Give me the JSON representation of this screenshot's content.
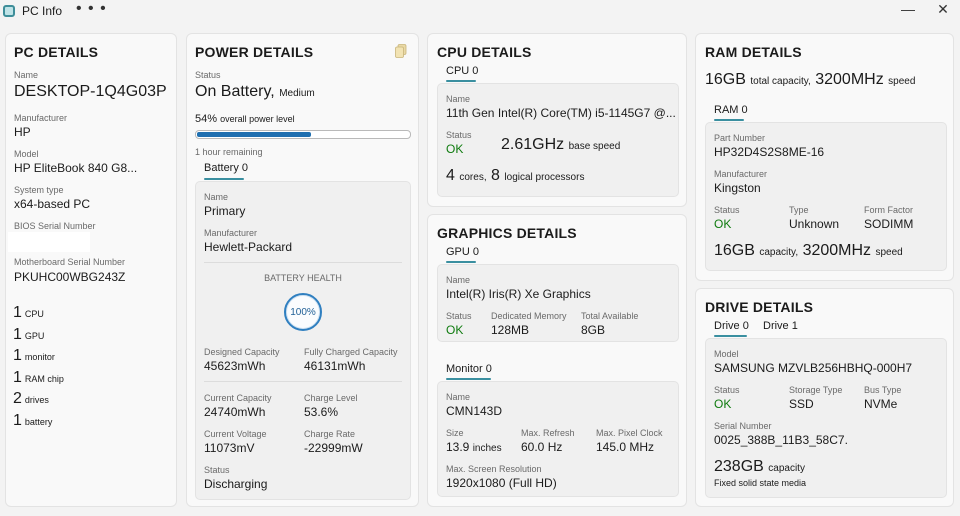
{
  "window": {
    "title": "PC Info",
    "more": "• • •",
    "minimize": "—",
    "close": "✕"
  },
  "pc": {
    "title": "PC DETAILS",
    "fields": [
      {
        "label": "Name",
        "value": "DESKTOP-1Q4G03P"
      },
      {
        "label": "Manufacturer",
        "value": "HP"
      },
      {
        "label": "Model",
        "value": "HP EliteBook 840 G8..."
      },
      {
        "label": "System type",
        "value": "x64-based PC"
      },
      {
        "label": "BIOS Serial Number",
        "value": ""
      },
      {
        "label": "Motherboard Serial Number",
        "value": "PKUHC00WBG243Z"
      }
    ],
    "counts": [
      {
        "n": "1",
        "unit": "CPU"
      },
      {
        "n": "1",
        "unit": "GPU"
      },
      {
        "n": "1",
        "unit": "monitor"
      },
      {
        "n": "1",
        "unit": "RAM chip"
      },
      {
        "n": "2",
        "unit": "drives"
      },
      {
        "n": "1",
        "unit": "battery"
      }
    ]
  },
  "power": {
    "title": "POWER DETAILS",
    "status_label": "Status",
    "status_value": "On Battery,",
    "status_level": "Medium",
    "percent": "54%",
    "percent_text": "overall power level",
    "level_fraction": 0.54,
    "time_left": "1 hour remaining",
    "tab": "Battery 0",
    "battery": {
      "name_label": "Name",
      "name": "Primary",
      "manufacturer_label": "Manufacturer",
      "manufacturer": "Hewlett-Packard",
      "health_label": "BATTERY HEALTH",
      "health": "100%",
      "designed_label": "Designed Capacity",
      "designed": "45623mWh",
      "full_label": "Fully Charged Capacity",
      "full": "46131mWh",
      "current_label": "Current Capacity",
      "current": "24740mWh",
      "charge_level_label": "Charge Level",
      "charge_level": "53.6%",
      "voltage_label": "Current Voltage",
      "voltage": "11073mV",
      "rate_label": "Charge Rate",
      "rate": "-22999mW",
      "status_label": "Status",
      "status": "Discharging"
    }
  },
  "cpu": {
    "title": "CPU DETAILS",
    "tab": "CPU 0",
    "name_label": "Name",
    "name": "11th Gen Intel(R) Core(TM) i5-1145G7 @...",
    "status_label": "Status",
    "status": "OK",
    "speed": "2.61GHz",
    "speed_text": "base speed",
    "cores": "4",
    "cores_text": "cores,",
    "logical": "8",
    "logical_text": "logical processors"
  },
  "graphics": {
    "title": "GRAPHICS DETAILS",
    "tab": "GPU 0",
    "name_label": "Name",
    "name": "Intel(R) Iris(R) Xe Graphics",
    "status_label": "Status",
    "status": "OK",
    "mem_label": "Dedicated Memory",
    "mem": "128MB",
    "total_label": "Total Available",
    "total": "8GB",
    "monitor_tab": "Monitor 0",
    "monitor": {
      "name_label": "Name",
      "name": "CMN143D",
      "size_label": "Size",
      "size": "13.9",
      "size_unit": "inches",
      "refresh_label": "Max. Refresh",
      "refresh": "60.0 Hz",
      "clock_label": "Max. Pixel Clock",
      "clock": "145.0 MHz",
      "res_label": "Max. Screen Resolution",
      "res": "1920x1080 (Full HD)"
    }
  },
  "ram": {
    "title": "RAM DETAILS",
    "capacity": "16GB",
    "capacity_text": "total capacity,",
    "speed": "3200MHz",
    "speed_text": "speed",
    "tab": "RAM 0",
    "part_label": "Part Number",
    "part": "HP32D4S2S8ME-16",
    "manufacturer_label": "Manufacturer",
    "manufacturer": "Kingston",
    "status_label": "Status",
    "status": "OK",
    "type_label": "Type",
    "type": "Unknown",
    "form_label": "Form Factor",
    "form": "SODIMM",
    "chip_capacity": "16GB",
    "chip_capacity_text": "capacity,",
    "chip_speed": "3200MHz",
    "chip_speed_text": "speed"
  },
  "drive": {
    "title": "DRIVE DETAILS",
    "tabs": [
      "Drive 0",
      "Drive 1"
    ],
    "model_label": "Model",
    "model": "SAMSUNG MZVLB256HBHQ-000H7",
    "status_label": "Status",
    "status": "OK",
    "storage_label": "Storage Type",
    "storage": "SSD",
    "bus_label": "Bus Type",
    "bus": "NVMe",
    "serial_label": "Serial Number",
    "serial": "0025_388B_11B3_58C7.",
    "capacity": "238GB",
    "capacity_text": "capacity",
    "media": "Fixed solid state media"
  },
  "colors": {
    "accent": "#3a8fa0",
    "ok": "#0f7b0f",
    "progress": "#1f6fb0"
  }
}
